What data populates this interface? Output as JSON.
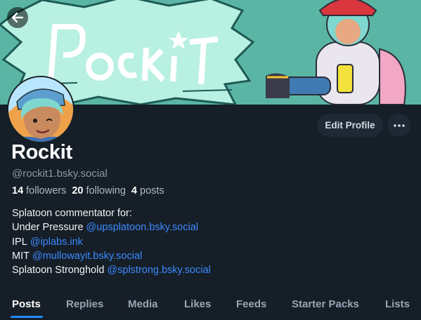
{
  "banner": {
    "logo_text": "Rockit"
  },
  "profile": {
    "display_name": "Rockit",
    "handle": "@rockit1.bsky.social",
    "stats": {
      "followers_count": "14",
      "followers_label": "followers",
      "following_count": "20",
      "following_label": "following",
      "posts_count": "4",
      "posts_label": "posts"
    },
    "bio": {
      "line1": "Splatoon commentator for:",
      "line2_text": "Under Pressure",
      "line2_link": "@upsplatoon.bsky.social",
      "line3_text": "IPL",
      "line3_link": "@iplabs.ink",
      "line4_text": "MIT",
      "line4_link": "@mullowayit.bsky.social",
      "line5_text": "Splatoon Stronghold",
      "line5_link": "@splstrong.bsky.social"
    }
  },
  "actions": {
    "edit_profile_label": "Edit Profile"
  },
  "tabs": [
    {
      "label": "Posts",
      "active": true
    },
    {
      "label": "Replies"
    },
    {
      "label": "Media"
    },
    {
      "label": "Likes"
    },
    {
      "label": "Feeds"
    },
    {
      "label": "Starter Packs"
    },
    {
      "label": "Lists"
    }
  ],
  "colors": {
    "background": "#161e27",
    "banner_teal": "#5bb5a4",
    "link": "#3b8bff",
    "tab_indicator": "#208bfe"
  },
  "icons": {
    "back": "arrow-left-icon",
    "more": "ellipsis-icon"
  }
}
